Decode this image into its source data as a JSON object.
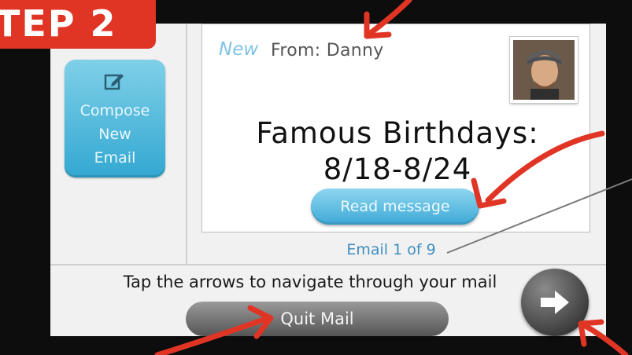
{
  "tutorial": {
    "step_label": "TEP 2"
  },
  "sidebar": {
    "compose_button": {
      "label": "Compose\nNew\nEmail",
      "icon": "compose-pencil-icon"
    }
  },
  "email": {
    "new_tag": "New",
    "from_text": "From: Danny",
    "sender_photo": "sender-avatar",
    "subject": "Famous Birthdays:",
    "subject_dates": "8/18-8/24",
    "read_button": "Read message",
    "count_text": "Email 1 of 9"
  },
  "footer": {
    "instruction": "Tap the arrows to navigate through your mail",
    "quit_button": "Quit Mail",
    "next_button": {
      "icon": "right-arrow-icon"
    }
  },
  "colors": {
    "accent_blue": "#3ea9d6",
    "annotation_red": "#e03524",
    "quit_gray": "#555555"
  }
}
